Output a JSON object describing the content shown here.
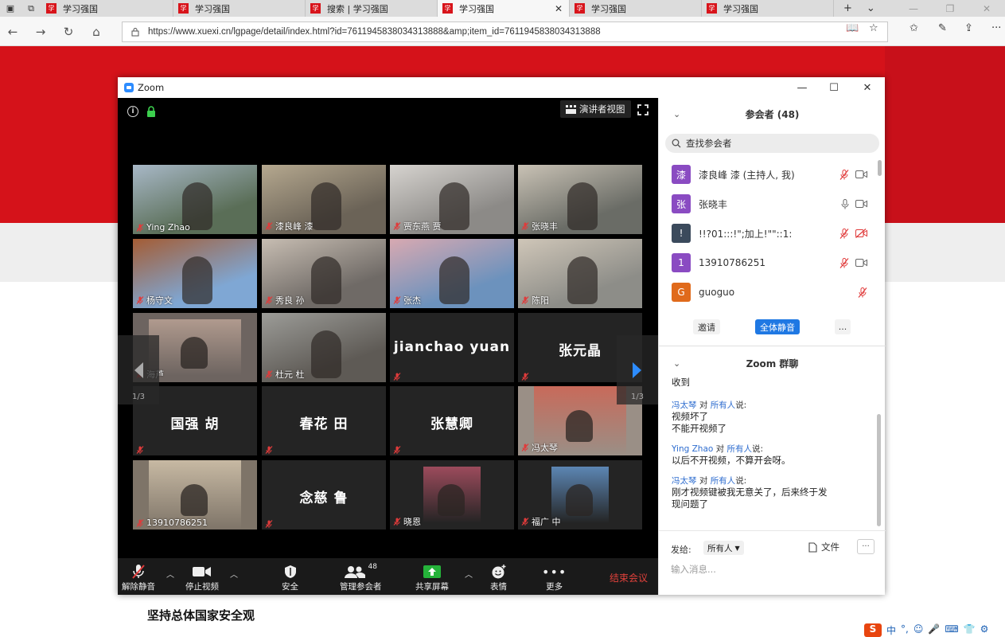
{
  "browser": {
    "tabs": [
      {
        "title": "学习强国",
        "active": false
      },
      {
        "title": "学习强国",
        "active": false
      },
      {
        "title": "搜索 | 学习强国",
        "active": false
      },
      {
        "title": "学习强国",
        "active": true
      },
      {
        "title": "学习强国",
        "active": false
      },
      {
        "title": "学习强国",
        "active": false
      }
    ],
    "tab_favicon": "学",
    "url": "https://www.xuexi.cn/lgpage/detail/index.html?id=7611945838034313888&amp;item_id=7611945838034313888"
  },
  "page": {
    "heading": "坚持总体国家安全观",
    "tray": [
      "中",
      "°,",
      "☺",
      "🎤",
      "⌨",
      "👕",
      "⚙"
    ],
    "sogou_label": "S"
  },
  "zoom": {
    "title": "Zoom",
    "speaker_view_label": "演讲者视图",
    "tiles": [
      {
        "name": "Ying Zhao",
        "bg": "#5a6e57",
        "accent": "#a8b8c7",
        "speaking": false
      },
      {
        "name": "漆良峰 漆",
        "bg": "#6b6357",
        "accent": "#b5a88f",
        "speaking": false
      },
      {
        "name": "贾东燕 贾",
        "bg": "#8c8a87",
        "accent": "#d6d3cf",
        "speaking": false
      },
      {
        "name": "张晓丰",
        "bg": "#6a6c66",
        "accent": "#c9c2b5",
        "speaking": true
      },
      {
        "name": "杨守文",
        "bg": "#7fa7d4",
        "accent": "#a45c34",
        "speaking": false
      },
      {
        "name": "秀良 孙",
        "bg": "#6f6a66",
        "accent": "#c7bdb2",
        "speaking": false
      },
      {
        "name": "张杰",
        "bg": "#6c92bd",
        "accent": "#d8a9b1",
        "speaking": false
      },
      {
        "name": "陈阳",
        "bg": "#8d8d88",
        "accent": "#cfc6b8",
        "speaking": false
      },
      {
        "name": "海芦",
        "bg": "#6d6460",
        "accent": "#b09a8e",
        "speaking": false
      },
      {
        "name": "杜元 杜",
        "bg": "#5e5a55",
        "accent": "#9c9c98",
        "speaking": false
      },
      {
        "name": "",
        "big": "jianchao yuan",
        "bg": "#242424",
        "speaking": false
      },
      {
        "name": "",
        "big": "张元晶",
        "bg": "#242424",
        "speaking": false
      },
      {
        "name": "",
        "big": "国强 胡",
        "bg": "#242424",
        "speaking": false
      },
      {
        "name": "",
        "big": "春花 田",
        "bg": "#242424",
        "speaking": false
      },
      {
        "name": "",
        "big": "张慧卿",
        "bg": "#242424",
        "speaking": false
      },
      {
        "name": "冯太琴",
        "bg": "#9a8f86",
        "accent": "#c86a5a",
        "speaking": false
      },
      {
        "name": "13910786251",
        "bg": "#7e7468",
        "accent": "#c7b9a3",
        "speaking": false
      },
      {
        "name": "",
        "big": "念慈 鲁",
        "bg": "#242424",
        "speaking": false
      },
      {
        "name": "晓恩",
        "bg": "#242424",
        "accent": "#9c4b5c",
        "speaking": false
      },
      {
        "name": "福广 中",
        "bg": "#242424",
        "accent": "#5c86b3",
        "speaking": false
      }
    ],
    "page_indicator": "1/3",
    "toolbar": {
      "unmute": "解除静音",
      "stop_video": "停止视频",
      "security": "安全",
      "participants": "管理参会者",
      "participants_count": "48",
      "share": "共享屏幕",
      "reactions": "表情",
      "more": "更多",
      "end": "结束会议"
    },
    "participants_panel": {
      "title": "参会者 (48)",
      "search_placeholder": "查找参会者",
      "people": [
        {
          "avatar": "漆",
          "name": "漆良峰 漆 (主持人, 我)",
          "color": "#8a4bc2",
          "mic": "muted",
          "video": "on"
        },
        {
          "avatar": "张",
          "name": "张晓丰",
          "color": "#8a4bc2",
          "mic": "on",
          "video": "on"
        },
        {
          "avatar": "!",
          "name": "!!?01:::!\";加上!\"\"::1:",
          "color": "#3b4a5c",
          "mic": "muted",
          "video": "off"
        },
        {
          "avatar": "1",
          "name": "13910786251",
          "color": "#8a4bc2",
          "mic": "muted",
          "video": "on"
        },
        {
          "avatar": "G",
          "name": "guoguo",
          "color": "#e06a1b",
          "mic": "muted",
          "video": "none"
        }
      ],
      "invite": "邀请",
      "mute_all": "全体静音",
      "more": "..."
    },
    "chat": {
      "title": "Zoom 群聊",
      "top_line": "收到",
      "messages": [
        {
          "sender": "冯太琴",
          "to_word": "对",
          "target": "所有人",
          "says": "说:",
          "lines": [
            "视频坏了",
            "不能开视频了"
          ]
        },
        {
          "sender": "Ying Zhao",
          "to_word": "对",
          "target": "所有人",
          "says": "说:",
          "lines": [
            "以后不开视频，不算开会呀。"
          ]
        },
        {
          "sender": "冯太琴",
          "to_word": "对",
          "target": "所有人",
          "says": "说:",
          "lines": [
            "刚才视频键被我无意关了，后来终于发",
            "现问题了"
          ]
        }
      ],
      "send_to_label": "发给:",
      "send_to_value": "所有人",
      "file_label": "文件",
      "more_label": "···",
      "input_placeholder": "输入消息..."
    }
  }
}
